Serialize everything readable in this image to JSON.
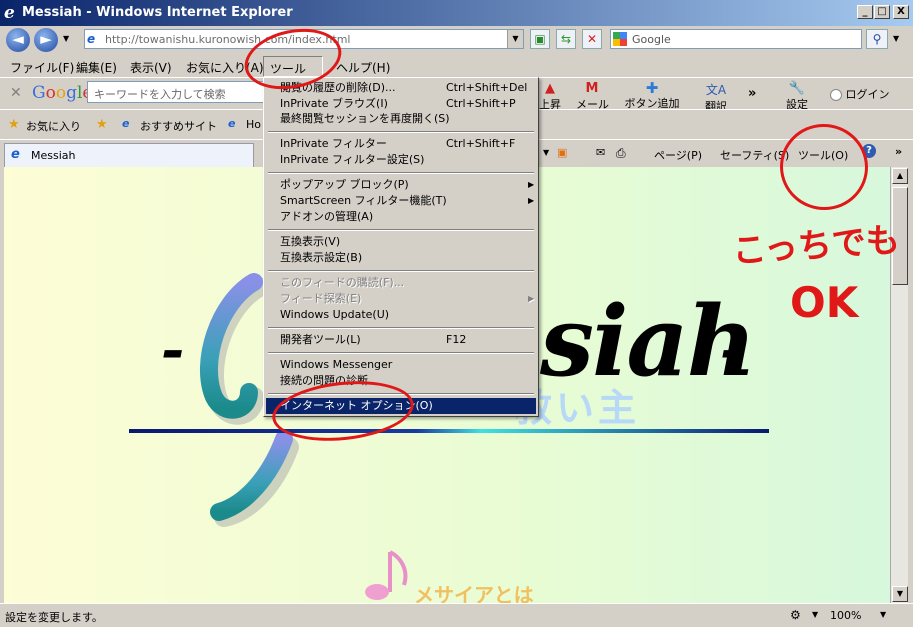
{
  "window": {
    "title": "Messiah - Windows Internet Explorer",
    "controls": {
      "minimize": "_",
      "maximize": "□",
      "close": "X"
    }
  },
  "address": {
    "url": "http://towanishu.kuronowish.com/index.html",
    "search_placeholder": "Google"
  },
  "menubar": {
    "items": [
      "ファイル(F)",
      "編集(E)",
      "表示(V)",
      "お気に入り(A)",
      "ツール(T)",
      "ヘルプ(H)"
    ]
  },
  "google_toolbar": {
    "logo": "Google",
    "search_placeholder": "キーワードを入力して検索",
    "buttons": [
      "上昇",
      "メール",
      "ボタン追加",
      "翻訳",
      "設定",
      "ログイン"
    ]
  },
  "favorites_bar": {
    "favorites_label": "お気に入り",
    "suggested_sites": "おすすめサイト",
    "hotmail": "Ho"
  },
  "tab": {
    "title": "Messiah"
  },
  "command_bar": {
    "page": "ページ(P)",
    "safety": "セーフティ(S)",
    "tools": "ツール(O)",
    "help": "?"
  },
  "tools_menu": {
    "items": [
      {
        "label": "閲覧の履歴の削除(D)...",
        "shortcut": "Ctrl+Shift+Del"
      },
      {
        "label": "InPrivate ブラウズ(I)",
        "shortcut": "Ctrl+Shift+P"
      },
      {
        "label": "最終閲覧セッションを再度開く(S)",
        "shortcut": ""
      },
      {
        "label": "InPrivate フィルター",
        "shortcut": "Ctrl+Shift+F"
      },
      {
        "label": "InPrivate フィルター設定(S)",
        "shortcut": ""
      },
      {
        "label": "ポップアップ ブロック(P)",
        "shortcut": ""
      },
      {
        "label": "SmartScreen フィルター機能(T)",
        "shortcut": ""
      },
      {
        "label": "アドオンの管理(A)",
        "shortcut": ""
      },
      {
        "label": "互換表示(V)",
        "shortcut": ""
      },
      {
        "label": "互換表示設定(B)",
        "shortcut": ""
      },
      {
        "label": "このフィードの購読(F)...",
        "shortcut": ""
      },
      {
        "label": "フィード探索(E)",
        "shortcut": ""
      },
      {
        "label": "Windows Update(U)",
        "shortcut": ""
      },
      {
        "label": "開発者ツール(L)",
        "shortcut": "F12"
      },
      {
        "label": "Windows Messenger",
        "shortcut": ""
      },
      {
        "label": "接続の問題の診断...",
        "shortcut": ""
      },
      {
        "label": "インターネット オプション(O)",
        "shortcut": ""
      }
    ]
  },
  "page": {
    "heading_dash_left": "-",
    "heading_text": "siah",
    "heading_dash_right": "-",
    "subtitle": "救い主",
    "link_text": "メサイアとは"
  },
  "annotation": {
    "line1": "こっちでも",
    "line2": "OK"
  },
  "statusbar": {
    "status": "設定を変更します。",
    "zoom": "100%"
  },
  "colors": {
    "annotation_red": "#e01818",
    "title_bar": "#0a246a",
    "selected_item": "#0a246a"
  }
}
